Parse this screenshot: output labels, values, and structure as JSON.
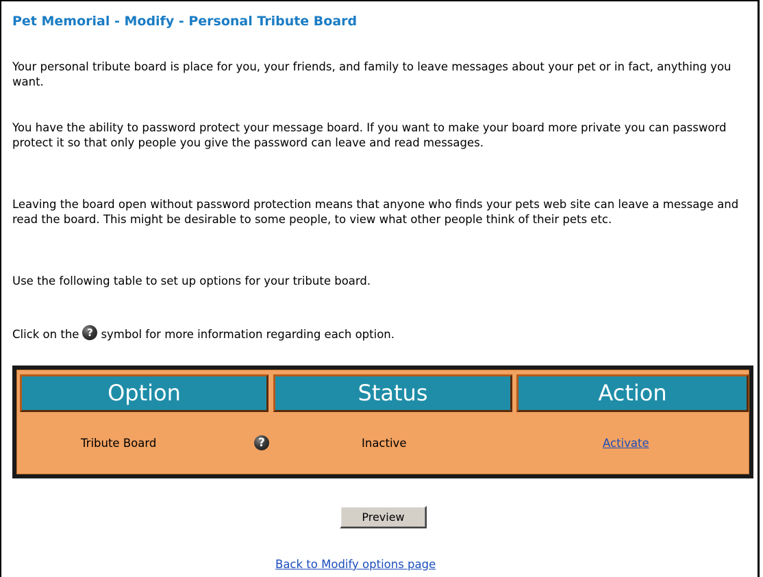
{
  "page": {
    "title": "Pet Memorial - Modify - Personal Tribute Board"
  },
  "intro": {
    "p1": "Your personal tribute board is place for you, your friends, and family to leave messages about your pet or in fact, anything you want.",
    "p2": "You have the ability to password protect your message board. If you want to make your board more private you can password protect it so that only people you give the password can leave and read messages.",
    "p3": "Leaving the board open without password protection means that anyone who finds your pets web site can leave a message and read the board. This might be desirable to some people, to view what other people think of their pets etc.",
    "p4": "Use the following table to set up options for your tribute board.",
    "p5_before": "Click on the",
    "p5_after": "symbol for more information regarding each option.",
    "help_glyph": "?"
  },
  "table": {
    "headers": [
      "Option",
      "Status",
      "Action"
    ],
    "rows": [
      {
        "option": "Tribute Board",
        "help_icon": "help-icon",
        "status": "Inactive",
        "action": "Activate"
      }
    ],
    "colors": {
      "header_bg": "#1f8da8",
      "row_bg": "#f2a261",
      "border": "#1a1a1a"
    }
  },
  "buttons": {
    "preview": "Preview"
  },
  "links": {
    "back": "Back to Modify options page"
  }
}
